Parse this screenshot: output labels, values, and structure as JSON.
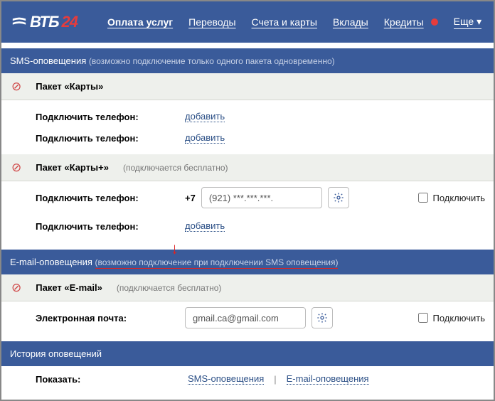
{
  "logo": {
    "text1": "ВТБ",
    "text2": "24"
  },
  "nav": {
    "items": [
      {
        "label": "Оплата услуг"
      },
      {
        "label": "Переводы"
      },
      {
        "label": "Счета и карты"
      },
      {
        "label": "Вклады"
      },
      {
        "label": "Кредиты"
      }
    ],
    "more": "Еще"
  },
  "sms": {
    "title": "SMS-оповещения",
    "sub": "(возможно подключение только одного пакета одновременно)",
    "pkg1": {
      "title": "Пакет «Карты»",
      "row_label": "Подключить телефон:",
      "add": "добавить"
    },
    "pkg2": {
      "title": "Пакет «Карты+»",
      "hint": "(подключается бесплатно)",
      "row_label": "Подключить телефон:",
      "prefix": "+7",
      "phone": "(921) ***.***.***.",
      "connect": "Подключить",
      "add": "добавить"
    }
  },
  "email": {
    "title": "E-mail-оповещения",
    "sub": "(возможно подключение при подключении SMS оповещения)",
    "pkg": {
      "title": "Пакет «E-mail»",
      "hint": "(подключается бесплатно)",
      "row_label": "Электронная почта:",
      "value": "gmail.ca@gmail.com",
      "connect": "Подключить"
    }
  },
  "history": {
    "title": "История оповещений",
    "show": "Показать:",
    "sms": "SMS-оповещения",
    "email": "E-mail-оповещения"
  }
}
